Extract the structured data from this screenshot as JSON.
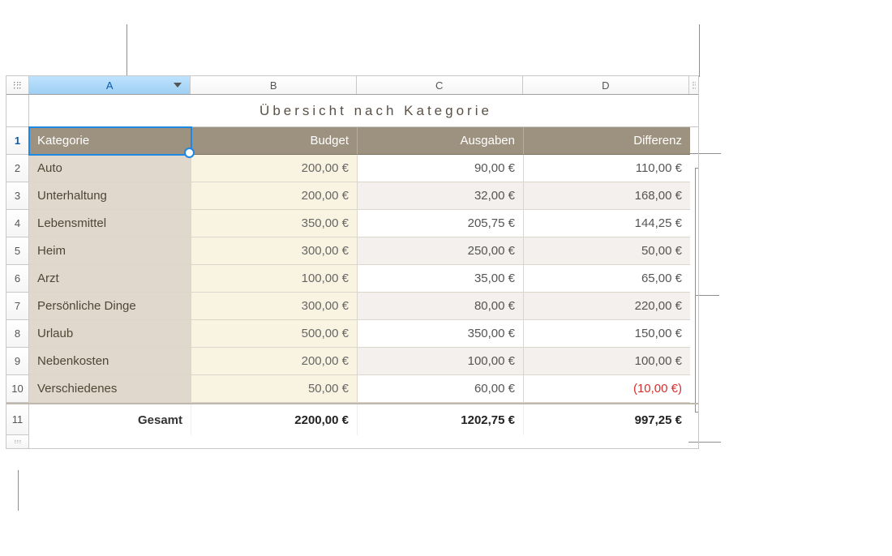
{
  "columns": {
    "a": "A",
    "b": "B",
    "c": "C",
    "d": "D"
  },
  "title": "Übersicht nach Kategorie",
  "header_row_num": "1",
  "headers": {
    "kategorie": "Kategorie",
    "budget": "Budget",
    "ausgaben": "Ausgaben",
    "differenz": "Differenz"
  },
  "rows": [
    {
      "num": "2",
      "a": "Auto",
      "b": "200,00 €",
      "c": "90,00 €",
      "d": "110,00 €"
    },
    {
      "num": "3",
      "a": "Unterhaltung",
      "b": "200,00 €",
      "c": "32,00 €",
      "d": "168,00 €"
    },
    {
      "num": "4",
      "a": "Lebensmittel",
      "b": "350,00 €",
      "c": "205,75 €",
      "d": "144,25 €"
    },
    {
      "num": "5",
      "a": "Heim",
      "b": "300,00 €",
      "c": "250,00 €",
      "d": "50,00 €"
    },
    {
      "num": "6",
      "a": "Arzt",
      "b": "100,00 €",
      "c": "35,00 €",
      "d": "65,00 €"
    },
    {
      "num": "7",
      "a": "Persönliche Dinge",
      "b": "300,00 €",
      "c": "80,00 €",
      "d": "220,00 €"
    },
    {
      "num": "8",
      "a": "Urlaub",
      "b": "500,00 €",
      "c": "350,00 €",
      "d": "150,00 €"
    },
    {
      "num": "9",
      "a": "Nebenkosten",
      "b": "200,00 €",
      "c": "100,00 €",
      "d": "100,00 €"
    },
    {
      "num": "10",
      "a": "Verschiedenes",
      "b": "50,00 €",
      "c": "60,00 €",
      "d": "(10,00 €)",
      "neg": true
    }
  ],
  "footer": {
    "num": "11",
    "a": "Gesamt",
    "b": "2200,00 €",
    "c": "1202,75 €",
    "d": "997,25 €"
  }
}
